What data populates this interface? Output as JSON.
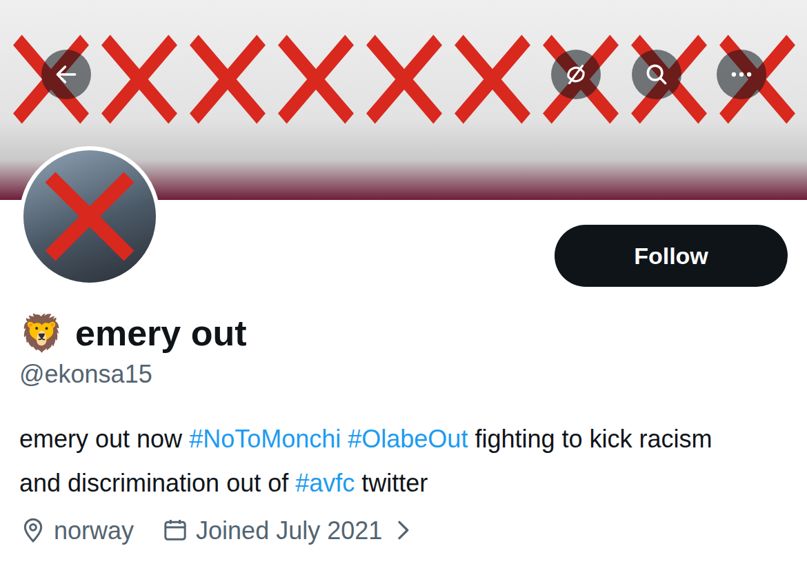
{
  "profile": {
    "follow_button": "Follow",
    "display_emoji": "🦁",
    "display_name": "emery out",
    "handle": "@ekonsa15",
    "bio": [
      {
        "text": "emery out now ",
        "kind": "text"
      },
      {
        "text": "#NoToMonchi",
        "kind": "hashtag"
      },
      {
        "text": " ",
        "kind": "text"
      },
      {
        "text": "#OlabeOut",
        "kind": "hashtag"
      },
      {
        "text": " fighting to kick racism and discrimination out of ",
        "kind": "text"
      },
      {
        "text": "#avfc",
        "kind": "hashtag"
      },
      {
        "text": " twitter",
        "kind": "text"
      }
    ],
    "location": "norway",
    "joined": "Joined July 2021"
  }
}
